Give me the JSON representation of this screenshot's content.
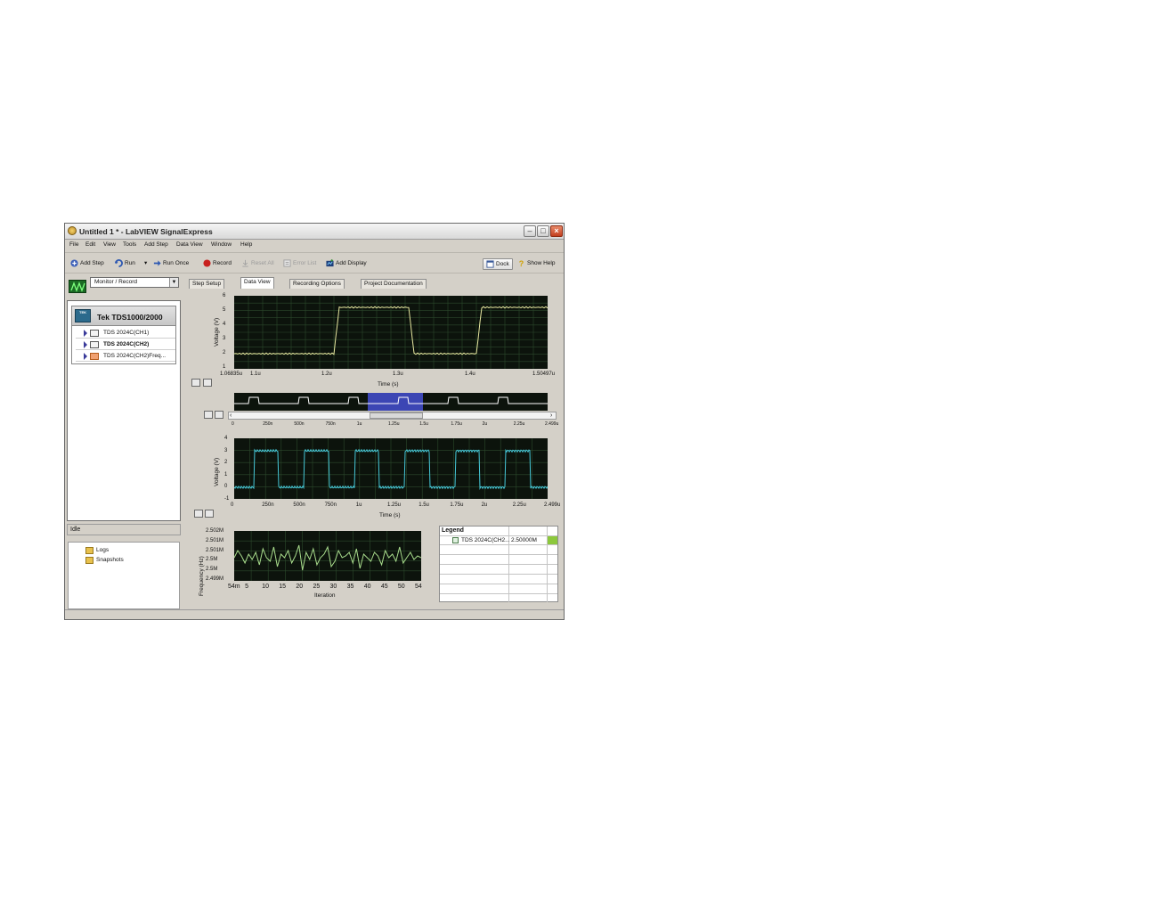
{
  "window": {
    "title": "Untitled 1 * - LabVIEW SignalExpress"
  },
  "menu": [
    "File",
    "Edit",
    "View",
    "Tools",
    "Add Step",
    "Data View",
    "Window",
    "Help"
  ],
  "toolbar": {
    "add_step": "Add Step",
    "run": "Run",
    "run_once": "Run Once",
    "record": "Record",
    "reset_all": "Reset All",
    "error_list": "Error List",
    "add_display": "Add Display",
    "dock": "Dock",
    "show_help": "Show Help"
  },
  "mode_select": {
    "value": "Monitor / Record"
  },
  "device": {
    "name": "Tek TDS1000/2000",
    "icon_text": "TEK",
    "channels": [
      {
        "label": "TDS 2024C(CH1)"
      },
      {
        "label": "TDS 2024C(CH2)"
      },
      {
        "label": "TDS 2024C(CH2)Freq..."
      }
    ]
  },
  "status_text": "Idle",
  "logs": {
    "logs": "Logs",
    "snapshots": "Snapshots"
  },
  "tabs": [
    "Step Setup",
    "Data View",
    "Recording Options",
    "Project Documentation"
  ],
  "graph1": {
    "ylabel": "Voltage (V)",
    "xlabel": "Time (s)",
    "yticks": [
      "6",
      "5",
      "4",
      "3",
      "2",
      "1"
    ],
    "xticks": [
      "1.06835u",
      "1.1u",
      "1.2u",
      "1.3u",
      "1.4u",
      "1.50497u"
    ]
  },
  "overview": {
    "xticks": [
      "0",
      "250n",
      "500n",
      "750n",
      "1u",
      "1.25u",
      "1.5u",
      "1.75u",
      "2u",
      "2.25u",
      "2.499u"
    ]
  },
  "graph2": {
    "ylabel": "Voltage (V)",
    "xlabel": "Time (s)",
    "yticks": [
      "4",
      "3",
      "2",
      "1",
      "0",
      "-1"
    ],
    "xticks": [
      "0",
      "250n",
      "500n",
      "750n",
      "1u",
      "1.25u",
      "1.5u",
      "1.75u",
      "2u",
      "2.25u",
      "2.499u"
    ]
  },
  "graph3": {
    "ylabel": "Frequency (Hz)",
    "xlabel": "Iteration",
    "yticks": [
      "2.502M",
      "2.501M",
      "2.501M",
      "2.5M",
      "2.5M",
      "2.499M"
    ],
    "xticks": [
      "54m",
      "5",
      "10",
      "15",
      "20",
      "25",
      "30",
      "35",
      "40",
      "45",
      "50",
      "54"
    ]
  },
  "legend": {
    "title": "Legend",
    "entry_name": "TDS 2024C(CH2...",
    "entry_value": "2.50000M"
  },
  "colors": {
    "plot_bg": "#0c130c",
    "grid": "#2c4a2c",
    "trace1": "#e8e8a0",
    "trace2": "#46c8d8",
    "trace3": "#a8dc8c",
    "overview_sel": "#3c46b4",
    "legend_swatch": "#8cc83c"
  }
}
